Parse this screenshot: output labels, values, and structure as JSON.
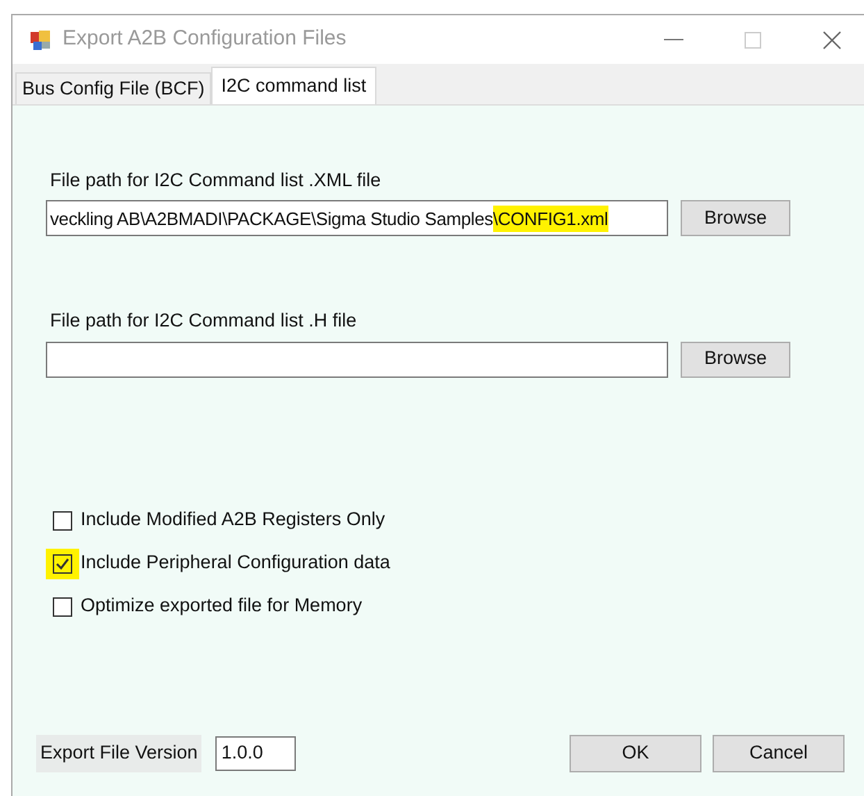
{
  "window": {
    "title": "Export A2B Configuration Files"
  },
  "tabs": [
    {
      "label": "Bus Config File (BCF)",
      "selected": false
    },
    {
      "label": "I2C command list",
      "selected": true
    }
  ],
  "file_fields": [
    {
      "label": "File path for I2C Command list .XML file",
      "value_parts": [
        {
          "text": "veckling AB\\A2BMADI\\PACKAGE\\Sigma Studio Samples",
          "highlighted": false
        },
        {
          "text": "\\CONFIG1.xml",
          "highlighted": true
        }
      ],
      "button": "Browse"
    },
    {
      "label": "File path for I2C Command list .H file",
      "button": "Browse"
    }
  ],
  "options": [
    {
      "label": "Include Modified A2B Registers Only",
      "checked": false,
      "highlighted": false
    },
    {
      "label": "Include Peripheral Configuration data",
      "checked": true,
      "highlighted": true
    },
    {
      "label": "Optimize exported file for Memory",
      "checked": false,
      "highlighted": false
    }
  ],
  "version": {
    "label": "Export File Version",
    "value": "1.0.0"
  },
  "buttons": [
    "OK",
    "Cancel"
  ]
}
